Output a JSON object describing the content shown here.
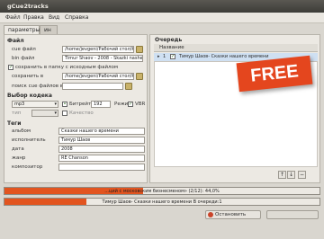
{
  "window": {
    "title": "gCue2tracks"
  },
  "menu": [
    "Файл",
    "Правка",
    "Вид",
    "Справка"
  ],
  "tabs": [
    {
      "label": "параметры",
      "active": true
    },
    {
      "label": "ин",
      "active": false
    }
  ],
  "file_section": {
    "heading": "Файл",
    "cue_label": "cue файл",
    "cue_value": "/home/jevgeni/Рабочий стол/К",
    "bin_label": "bin файл",
    "bin_value": "Timur Shaov - 2008 - Skazki nashego vren",
    "same_folder_checked": true,
    "same_folder_label": "сохранить в папку с исходным файлом",
    "save_label": "сохранить в",
    "save_value": "/home/jevgeni/Рабочий стол/К",
    "search_label": "поиск cue файлов в",
    "search_value": ""
  },
  "codec_section": {
    "heading": "Выбор кодека",
    "codec": "mp3",
    "bitrate_label": "Битрейт",
    "bitrate_value": "192",
    "mode_label": "Режим:",
    "vbr_checked": true,
    "vbr_label": "VBR",
    "type_label": "тип",
    "quality_label": "Качество"
  },
  "tags_section": {
    "heading": "Теги",
    "album_label": "альбом",
    "album_value": "Сказки нашего времени",
    "artist_label": "исполнитель",
    "artist_value": "Тимур Шаов",
    "date_label": "дата",
    "date_value": "2008",
    "genre_label": "жанр",
    "genre_value": "RE Chanson",
    "composer_label": "композитор",
    "composer_value": ""
  },
  "queue": {
    "heading": "Очередь",
    "column": "Название",
    "row": "Тимур Шаов- Сказки нашего времени"
  },
  "progress": [
    {
      "text": "...ций с московским бизнесменом» (2/12): 44,0%",
      "fraction": 0.44
    },
    {
      "text": "Тимур Шаов- Сказки нашего времени  В очереди:1",
      "fraction": 0.26
    }
  ],
  "buttons": {
    "stop": "Остановить"
  },
  "badge": {
    "text": "FREE",
    "color": "#e4461e"
  },
  "colors": {
    "accent": "#e2541f"
  }
}
